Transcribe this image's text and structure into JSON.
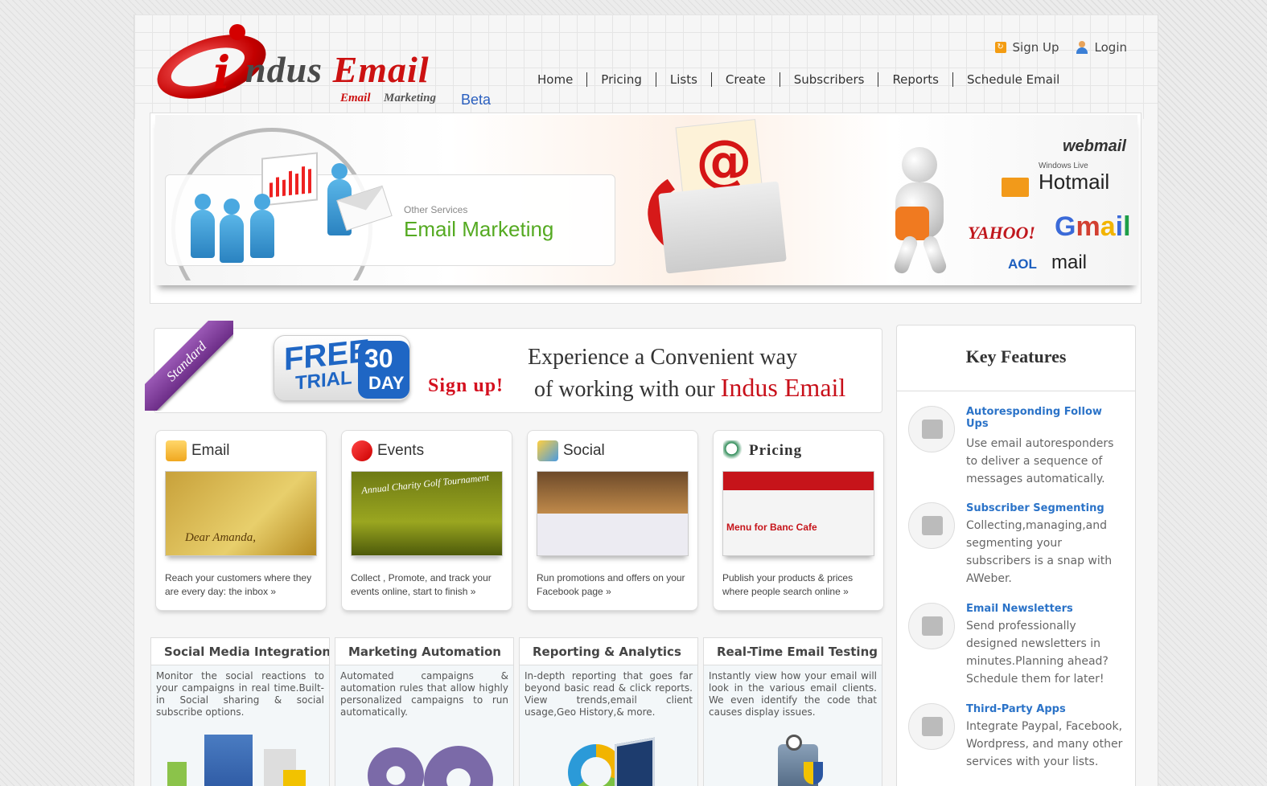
{
  "logo": {
    "brand_i": "i",
    "brand_rest": "ndus",
    "brand_email": "Email",
    "tag_email": "Email",
    "tag_marketing": "Marketing",
    "beta": "Beta"
  },
  "toplinks": {
    "signup": "Sign Up",
    "login": "Login"
  },
  "nav": [
    "Home",
    "Pricing",
    "Lists",
    "Create",
    "Subscribers",
    "Reports",
    "Schedule Email"
  ],
  "banner": {
    "small": "Other Services",
    "big": "Email Marketing",
    "at": "@",
    "webmail": "webmail",
    "windows_live": "Windows Live",
    "hotmail": "Hotmail",
    "yahoo": "YAHOO!",
    "gmail": "Gmail",
    "aol": "AOL",
    "aol_mail": "mail"
  },
  "trial": {
    "ribbon": "Standard",
    "free": "FREE",
    "trial_word": "TRIAL",
    "thirty": "30",
    "day": "DAY",
    "signup": "Sign up!",
    "line1": "Experience a Convenient way",
    "line2": "of working with our",
    "brand": "Indus Email"
  },
  "cards": [
    {
      "title": "Email",
      "desc": "Reach your customers where they are every day: the inbox »",
      "img_caption": "Dear Amanda,"
    },
    {
      "title": "Events",
      "desc": "Collect , Promote, and track your events online, start to finish »",
      "img_caption": "Annual Charity Golf Tournament"
    },
    {
      "title": "Social",
      "desc": "Run promotions and offers on your Facebook page »",
      "img_caption": ""
    },
    {
      "title": "Pricing",
      "desc": "Publish your products & prices where people search online »",
      "img_caption": "Menu for Banc Cafe"
    }
  ],
  "features": [
    {
      "title": "Social Media Integration",
      "text": "Monitor the social reactions to your campaigns in real time.Built-in Social sharing & social subscribe options."
    },
    {
      "title": "Marketing Automation",
      "text": "Automated campaigns & automation rules that allow highly personalized campaigns to run automatically."
    },
    {
      "title": "Reporting & Analytics",
      "text": "In-depth reporting that goes far beyond basic read & click reports. View trends,email client usage,Geo History,& more."
    },
    {
      "title": "Real-Time Email Testing",
      "text": "Instantly view how your email will look in the various email clients. We even identify the code that causes display issues."
    }
  ],
  "key_features": {
    "title": "Key Features",
    "items": [
      {
        "head": "Autoresponding Follow Ups",
        "text": "Use email autoresponders to deliver a sequence of messages automatically.",
        "icon": "stack-icon"
      },
      {
        "head": "Subscriber Segmenting",
        "text": "Collecting,managing,and segmenting your subscribers is a snap with AWeber.",
        "icon": "group-icon"
      },
      {
        "head": "Email Newsletters",
        "text": "Send professionally designed newsletters in minutes.Planning ahead? Schedule them for later!",
        "icon": "envelope-icon"
      },
      {
        "head": "Third-Party Apps",
        "text": "Integrate Paypal, Facebook, Wordpress, and many other services with your lists.",
        "icon": "gears-icon"
      }
    ]
  },
  "colors": {
    "accent_red": "#d40000",
    "link_blue": "#2b73c8",
    "green": "#55aa22",
    "ribbon_purple": "#6c2d87"
  }
}
